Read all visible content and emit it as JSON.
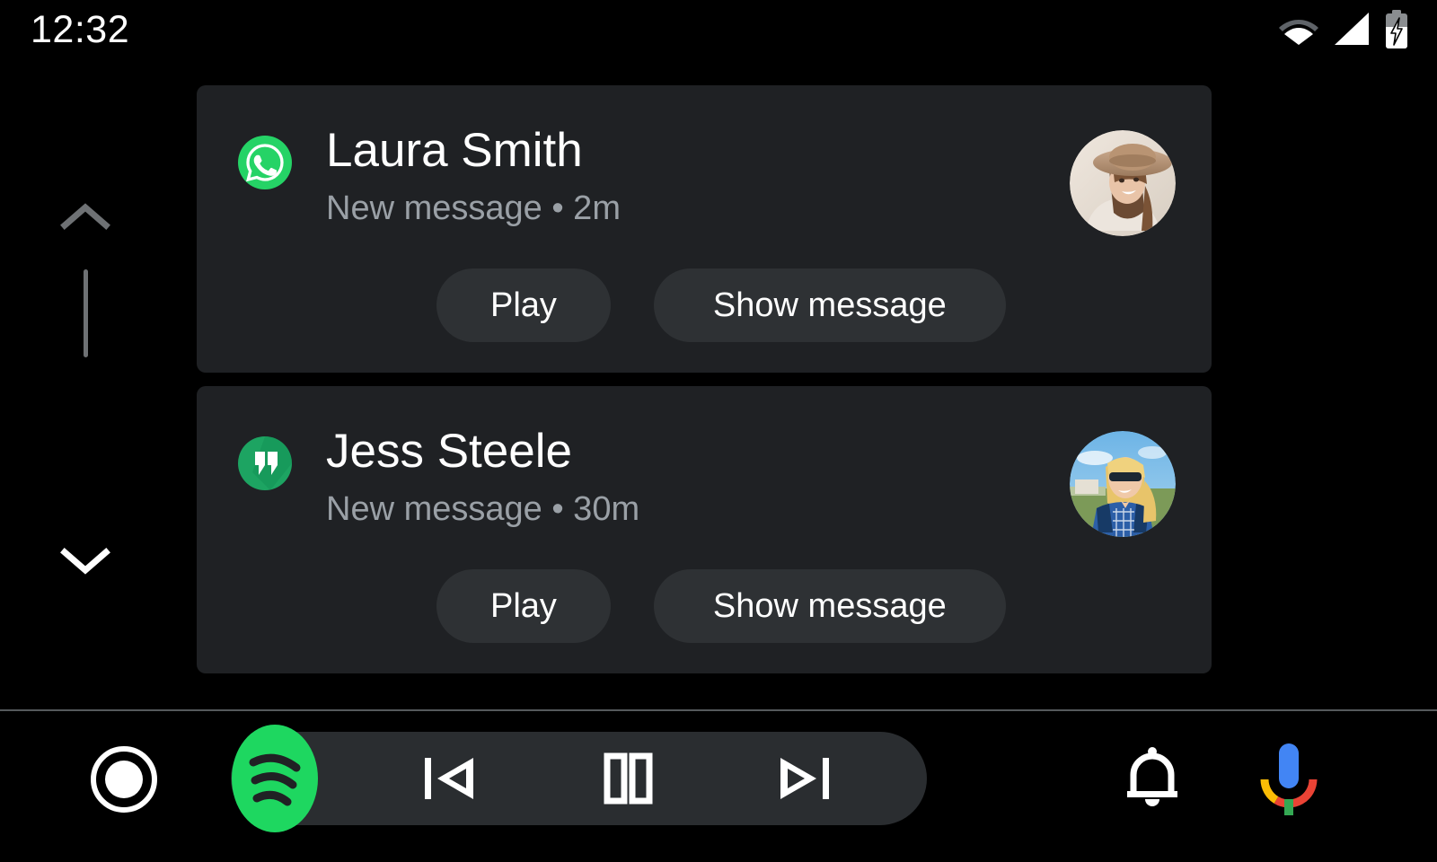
{
  "status_bar": {
    "clock": "12:32",
    "icons": [
      {
        "name": "wifi-icon",
        "label": "Wi-Fi"
      },
      {
        "name": "cellular-signal-icon",
        "label": "Cellular signal"
      },
      {
        "name": "battery-charging-icon",
        "label": "Battery charging"
      }
    ]
  },
  "scroll": {
    "up_label": "Scroll up",
    "down_label": "Scroll down",
    "thumb_label": "Scroll position"
  },
  "notifications": [
    {
      "app": "whatsapp",
      "app_icon": "whatsapp-icon",
      "sender": "Laura Smith",
      "subtitle": "New message • 2m",
      "avatar": "avatar-laura-smith",
      "actions": [
        {
          "name": "play-button",
          "label": "Play"
        },
        {
          "name": "show-message-button",
          "label": "Show message"
        }
      ]
    },
    {
      "app": "hangouts",
      "app_icon": "hangouts-icon",
      "sender": "Jess Steele",
      "subtitle": "New message • 30m",
      "avatar": "avatar-jess-steele",
      "actions": [
        {
          "name": "play-button",
          "label": "Play"
        },
        {
          "name": "show-message-button",
          "label": "Show message"
        }
      ]
    }
  ],
  "bottom_nav": {
    "home": {
      "name": "home-button",
      "label": "Home"
    },
    "media": {
      "app_icon": "spotify-icon",
      "app_label": "Spotify",
      "previous": {
        "name": "previous-track-button",
        "label": "Previous"
      },
      "pause": {
        "name": "pause-button",
        "label": "Pause"
      },
      "next": {
        "name": "next-track-button",
        "label": "Next"
      }
    },
    "notifications": {
      "name": "notifications-button",
      "label": "Notifications"
    },
    "assistant": {
      "name": "assistant-button",
      "label": "Google Assistant"
    }
  },
  "colors": {
    "background": "#000000",
    "card": "#1f2124",
    "button": "#2e3134",
    "media_pill": "#2a2d30",
    "primary_text": "#ffffff",
    "secondary_text": "#9aa0a6",
    "whatsapp_green": "#25d366",
    "hangouts_green": "#1da462",
    "spotify_green": "#1ed760",
    "divider": "#55595c"
  }
}
